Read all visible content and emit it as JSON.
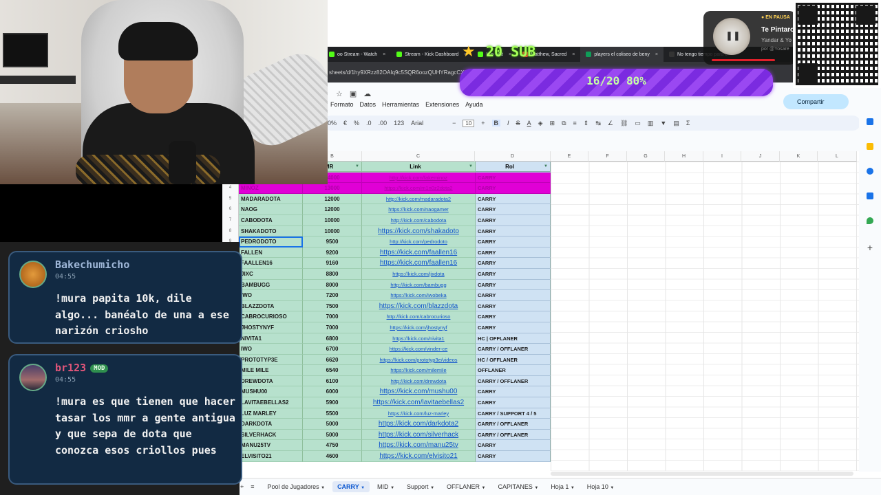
{
  "browser": {
    "tabs": [
      {
        "label": "oo Stream - Watch",
        "color": "#53fc18"
      },
      {
        "label": "Stream - Kick Dashboard",
        "color": "#53fc18"
      },
      {
        "label": "K   o - Alt",
        "color": "#53fc18"
      },
      {
        "label": "Matthew, Sacred",
        "color": "#ff4444"
      },
      {
        "label": "players el coliseo de beny",
        "color": "#0f9d58"
      },
      {
        "label": "No tengo tiempo para c",
        "color": "#333333"
      }
    ],
    "url": "sheets/d/1hy9XRzz82OAIq9c5SQR6oozQUHYRagcCXHCaafH5"
  },
  "sheets": {
    "menus": [
      "Formato",
      "Datos",
      "Herramientas",
      "Extensiones",
      "Ayuda"
    ],
    "toolbar": {
      "zoom": "0%",
      "currency": "€",
      "percent": "%",
      "dec_less": ".0",
      "dec_more": ".00",
      "format_123": "123",
      "font": "Arial",
      "minus": "−",
      "font_size": "10",
      "plus": "+",
      "bold": "B",
      "italic": "I",
      "strike": "S",
      "textcolor": "A",
      "sigma": "Σ"
    },
    "share_label": "Compartir",
    "columns": [
      "B",
      "C",
      "D",
      "E",
      "F",
      "G",
      "H",
      "I",
      "J",
      "K",
      "L"
    ],
    "header": {
      "mmr": "MR",
      "link": "Link",
      "rol": "Rol"
    },
    "rows": [
      {
        "n": "",
        "name": "",
        "mmr": "4000",
        "link": "https://kick.com/daadota2",
        "big": false,
        "rol": "CARRY",
        "magenta": false
      },
      {
        "n": "3",
        "name": "MINOZ",
        "mmr": "14000",
        "link": "http://kick.com/fakeminoz",
        "big": false,
        "rol": "CARRY",
        "magenta": true
      },
      {
        "n": "4",
        "name": "MINOZ",
        "mmr": "13000",
        "link": "https://kick.com/m1n0z2dota2",
        "big": false,
        "rol": "CARRY",
        "magenta": true
      },
      {
        "n": "5",
        "name": "MADARADOTA",
        "mmr": "12000",
        "link": "http://kick.com/madaradota2",
        "big": false,
        "rol": "CARRY",
        "magenta": false
      },
      {
        "n": "6",
        "name": "NAOG",
        "mmr": "12000",
        "link": "https://kick.com/naogamer",
        "big": false,
        "rol": "CARRY",
        "magenta": false
      },
      {
        "n": "7",
        "name": "CABODOTA",
        "mmr": "10000",
        "link": "http://kick.com/cabodota",
        "big": false,
        "rol": "CARRY",
        "magenta": false
      },
      {
        "n": "8",
        "name": "SHAKADOTO",
        "mmr": "10000",
        "link": "https://kick.com/shakadoto",
        "big": true,
        "rol": "CARRY",
        "magenta": false
      },
      {
        "n": "9",
        "name": "PEDRODOTO",
        "mmr": "9500",
        "link": "http://kick.com/pedrodoto",
        "big": false,
        "rol": "CARRY",
        "magenta": false,
        "selected": true
      },
      {
        "n": "10",
        "name": "FALLEN",
        "mmr": "9200",
        "link": "https://kick.com/faallen16",
        "big": true,
        "rol": "CARRY",
        "magenta": false
      },
      {
        "n": "11",
        "name": "FAALLEN16",
        "mmr": "9160",
        "link": "https://kick.com/faallen16",
        "big": true,
        "rol": "CARRY",
        "magenta": false
      },
      {
        "n": "12",
        "name": "JIXC",
        "mmr": "8800",
        "link": "https://kick.com/jixdota",
        "big": false,
        "rol": "CARRY",
        "magenta": false
      },
      {
        "n": "13",
        "name": "BAMBUGG",
        "mmr": "8000",
        "link": "http://kick.com/bambugg",
        "big": false,
        "rol": "CARRY",
        "magenta": false
      },
      {
        "n": "14",
        "name": "IWO",
        "mmr": "7200",
        "link": "https://kick.com/iwobeka",
        "big": false,
        "rol": "CARRY",
        "magenta": false
      },
      {
        "n": "15",
        "name": "BLAZZDOTA",
        "mmr": "7500",
        "link": "https://kick.com/blazzdota",
        "big": true,
        "rol": "CARRY",
        "magenta": false
      },
      {
        "n": "16",
        "name": "CABROCURIOSO",
        "mmr": "7000",
        "link": "http://kick.com/cabrocurioso",
        "big": false,
        "rol": "CARRY",
        "magenta": false
      },
      {
        "n": "17",
        "name": "JHOSTYNYF",
        "mmr": "7000",
        "link": "https://kick.com/jhostynyf",
        "big": false,
        "rol": "CARRY",
        "magenta": false
      },
      {
        "n": "18",
        "name": "NIVITA1",
        "mmr": "6800",
        "link": "https://kick.com/nivita1",
        "big": false,
        "rol": "HC | OFFLANER",
        "magenta": false
      },
      {
        "n": "19",
        "name": "IWO",
        "mmr": "6700",
        "link": "https://kick.com/vinder-ce",
        "big": false,
        "rol": "CARRY / OFFLANER",
        "magenta": false
      },
      {
        "n": "20",
        "name": "PROTOTYP3E",
        "mmr": "6620",
        "link": "https://kick.com/prototyp3e/videos",
        "big": false,
        "rol": "HC / OFFLANER",
        "magenta": false
      },
      {
        "n": "21",
        "name": "MILE MILE",
        "mmr": "6540",
        "link": "https://kick.com/milemile",
        "big": false,
        "rol": "OFFLANER",
        "magenta": false
      },
      {
        "n": "22",
        "name": "DREWDOTA",
        "mmr": "6100",
        "link": "http://kick.com/drewdota",
        "big": false,
        "rol": "CARRY / OFFLANER",
        "magenta": false
      },
      {
        "n": "23",
        "name": "MUSHU00",
        "mmr": "6000",
        "link": "https://kick.com/mushu00",
        "big": true,
        "rol": "CARRY",
        "magenta": false
      },
      {
        "n": "24",
        "name": "LAVITAEBELLAS2",
        "mmr": "5900",
        "link": "https://kick.com/lavitaebellas2",
        "big": true,
        "rol": "CARRY",
        "magenta": false
      },
      {
        "n": "25",
        "name": "LUZ MARLEY",
        "mmr": "5500",
        "link": "https://kick.com/luz-marley",
        "big": false,
        "rol": "CARRY / SUPPORT 4 / 5",
        "magenta": false
      },
      {
        "n": "26",
        "name": "DARKDOTA",
        "mmr": "5000",
        "link": "https://kick.com/darkdota2",
        "big": true,
        "rol": "CARRY / OFFLANER",
        "magenta": false
      },
      {
        "n": "27",
        "name": "SILVERHACK",
        "mmr": "5000",
        "link": "https://kick.com/silverhack",
        "big": true,
        "rol": "CARRY / OFFLANER",
        "magenta": false
      },
      {
        "n": "28",
        "name": "MANU25TV",
        "mmr": "4750",
        "link": "https://kick.com/manu25tv",
        "big": true,
        "rol": "CARRY",
        "magenta": false
      },
      {
        "n": "29",
        "name": "ELVISITO21",
        "mmr": "4600",
        "link": "https://kick.com/elvisito21",
        "big": true,
        "rol": "CARRY",
        "magenta": false
      }
    ],
    "sheet_tabs": [
      "Pool de Jugadores",
      "CARRY",
      "MID",
      "Support",
      "OFFLANER",
      "CAPITANES",
      "Hoja 1",
      "Hoja 10"
    ],
    "active_tab": "CARRY"
  },
  "chat": {
    "messages": [
      {
        "user": "Bakechumicho",
        "user_color": "#9fb7d8",
        "time": "04:55",
        "text": "!mura papita 10k, dile algo... banéalo de una a ese narizón criosho",
        "mod": false
      },
      {
        "user": "br123",
        "user_color": "#e2567a",
        "time": "04:55",
        "text": "!mura es que tienen que hacer tasar los mmr a gente antigua y que sepa de dota que conozca esos criollos pues",
        "mod": true,
        "badge": "MOD"
      }
    ]
  },
  "overlay": {
    "sub_title": "20 SUB",
    "sub_progress": "16/20 80%",
    "sub_fraction": 0.8,
    "now_playing": {
      "status": "EN PAUSA",
      "title": "Te Pintaro",
      "artist": "Yandar & Yo",
      "by": "por @Yosare"
    }
  }
}
